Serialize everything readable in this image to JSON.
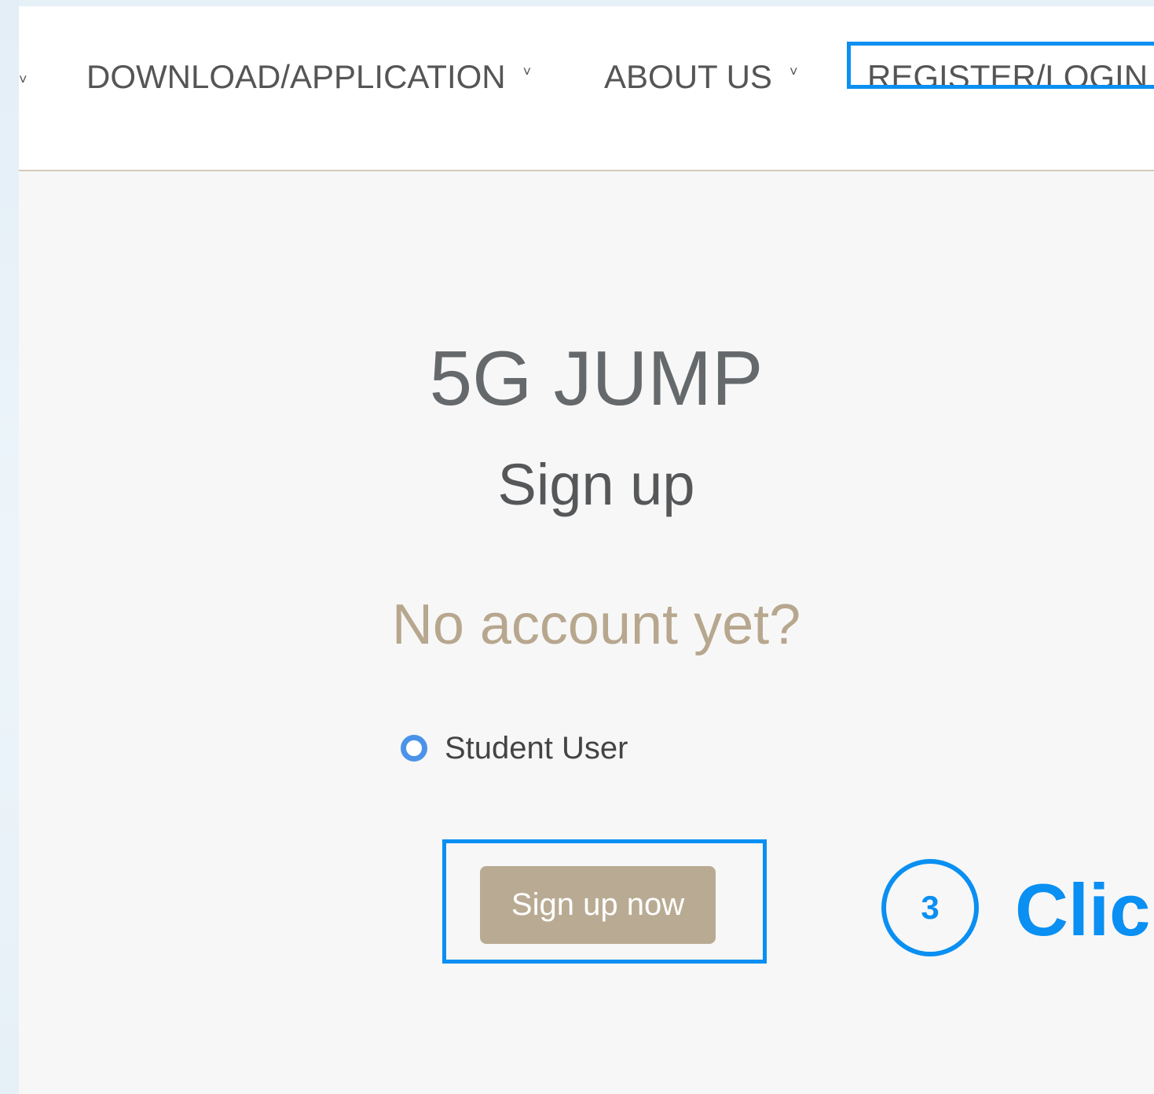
{
  "nav": {
    "items": [
      {
        "label": "DOWNLOAD/APPLICATION",
        "caret": "˅"
      },
      {
        "label": "ABOUT US",
        "caret": "˅"
      },
      {
        "label": "REGISTER/LOGIN"
      }
    ],
    "left_chevron": "˅"
  },
  "main": {
    "brand": "5G JUMP",
    "title": "Sign up",
    "question": "No account yet?",
    "user_type_option": "Student User",
    "signup_button": "Sign up now"
  },
  "annotation": {
    "step_number": "3",
    "step_text": "Click",
    "color": "#0a8ff2"
  }
}
